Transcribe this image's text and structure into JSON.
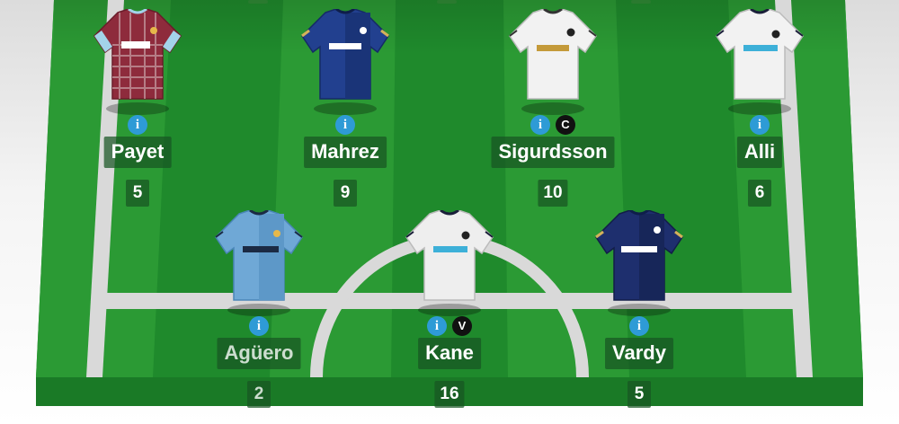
{
  "colors": {
    "pitch_dark": "#1f8a2c",
    "pitch_light": "#3aad3f",
    "line": "#d9d9d9",
    "info_badge": "#2e9bd6",
    "role_badge": "#111111"
  },
  "players": [
    {
      "name": "Payet",
      "points": "5",
      "role": "",
      "shirt": "west-ham-shirt-icon"
    },
    {
      "name": "Mahrez",
      "points": "9",
      "role": "",
      "shirt": "leicester-shirt-icon"
    },
    {
      "name": "Sigurdsson",
      "points": "10",
      "role": "C",
      "shirt": "swansea-shirt-icon"
    },
    {
      "name": "Alli",
      "points": "6",
      "role": "",
      "shirt": "tottenham-shirt-icon"
    },
    {
      "name": "Agüero",
      "points": "2",
      "role": "",
      "shirt": "man-city-shirt-icon"
    },
    {
      "name": "Kane",
      "points": "16",
      "role": "V",
      "shirt": "tottenham-shirt-icon"
    },
    {
      "name": "Vardy",
      "points": "5",
      "role": "",
      "shirt": "leicester-shirt-icon"
    }
  ],
  "info_label": "i"
}
